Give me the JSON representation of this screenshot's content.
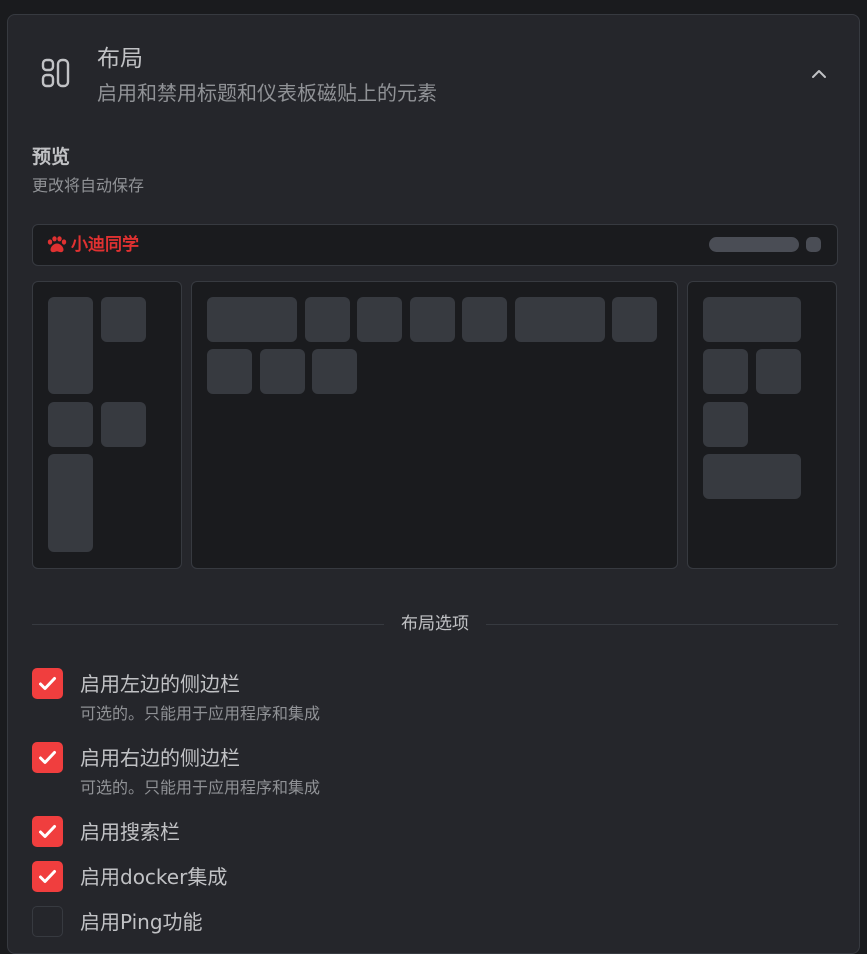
{
  "section": {
    "title": "布局",
    "subtitle": "启用和禁用标题和仪表板磁贴上的元素",
    "icon": "layout-icon",
    "collapse_icon": "chevron-up-icon"
  },
  "preview": {
    "title": "预览",
    "subtitle": "更改将自动保存",
    "header_bar": {
      "logo_icon": "paw-icon",
      "logo_text": "小迪同学",
      "brand_color": "#e03131"
    }
  },
  "divider": {
    "label": "布局选项"
  },
  "options": [
    {
      "label": "启用左边的侧边栏",
      "description": "可选的。只能用于应用程序和集成",
      "checked": true
    },
    {
      "label": "启用右边的侧边栏",
      "description": "可选的。只能用于应用程序和集成",
      "checked": true
    },
    {
      "label": "启用搜索栏",
      "checked": true
    },
    {
      "label": "启用docker集成",
      "checked": true
    },
    {
      "label": "启用Ping功能",
      "checked": false
    }
  ],
  "colors": {
    "accent": "#f03e3e",
    "panel_bg": "#25262b",
    "preview_bg": "#1a1b1e",
    "tile": "#373a40"
  }
}
